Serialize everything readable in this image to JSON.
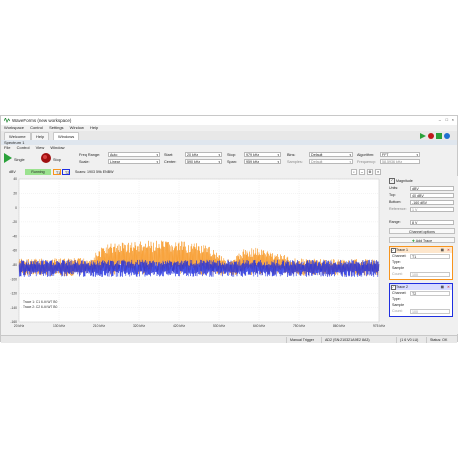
{
  "window": {
    "title": "WaveForms (new workspace)"
  },
  "menu": [
    "Workspace",
    "Control",
    "Settings",
    "Window",
    "Help"
  ],
  "tabs": [
    {
      "label": "Welcome"
    },
    {
      "label": "Help"
    },
    {
      "label": "Windows"
    }
  ],
  "document": {
    "title": "Spectrum 1"
  },
  "doc_menu": [
    "File",
    "Control",
    "View",
    "Window"
  ],
  "toolbar": {
    "single_label": "Single",
    "stop_label": "Stop",
    "freq_range_label": "Freq Range:",
    "freq_range_value": "Auto",
    "scale_label": "Scale:",
    "scale_value": "Linear",
    "start_label": "Start:",
    "start_value": "20 kHz",
    "center_label": "Center:",
    "center_value": "590 kHz",
    "stop_freq_label": "Stop:",
    "stop_freq_value": "979 kHz",
    "span_label": "Span:",
    "span_value": "959 kHz",
    "bins_label": "Bins:",
    "bins_value": "Default",
    "samples_label": "Samples:",
    "samples_value": "Default",
    "algorithm_label": "Algorithm:",
    "algorithm_value": "FFT",
    "frequency_label": "Frequency:",
    "frequency_value": "58.5936 kHz"
  },
  "plotbar": {
    "unit": "dBV",
    "status": "Running",
    "trace_buttons": [
      "T1",
      "T2"
    ],
    "info": "Scans: 1903 59k ENBW"
  },
  "panel": {
    "magnitude_label": "Magnitude",
    "units_label": "Units:",
    "units_value": "dBV",
    "top_label": "Top:",
    "top_value": "40 dBV",
    "bottom_label": "Bottom:",
    "bottom_value": "-160 dBV",
    "reference_label": "Reference:",
    "reference_value": "1 V",
    "range_label": "Range:",
    "range_value": "8 V",
    "channel_options": "Channel options",
    "add_trace": "Add Trace",
    "traces": [
      {
        "name": "Trace 1",
        "channel_label": "Channel:",
        "channel_value": "T1",
        "type_label": "Type:",
        "type_value": "Sample",
        "count_label": "Count:",
        "count_value": "100",
        "color": "#f7941d"
      },
      {
        "name": "Trace 2",
        "channel_label": "Channel:",
        "channel_value": "T2",
        "type_label": "Type:",
        "type_value": "Sample",
        "count_label": "Count:",
        "count_value": "100",
        "color": "#1f2fe0"
      }
    ]
  },
  "legend": [
    {
      "text": "Trace 1: C1 6.4t W7 B0"
    },
    {
      "text": "Trace 2: C2 6.4t W7 B0"
    }
  ],
  "statusbar": {
    "trigger": "Manual Trigger",
    "device": "AD2 (SN:210321A9E2 8A3)",
    "voltage": "(1 6 V0 LU)",
    "status": "Status: OK"
  },
  "chart_data": {
    "type": "line",
    "xlabel": "",
    "ylabel": "",
    "x_ticks": [
      "20 kHz",
      "130 kHz",
      "210 kHz",
      "320 kHz",
      "420 kHz",
      "530 kHz",
      "640 kHz",
      "750 kHz",
      "860 kHz",
      "975 kHz"
    ],
    "y_ticks": [
      40,
      20,
      0,
      -20,
      -40,
      -60,
      -80,
      -100,
      -120,
      -140,
      -160
    ],
    "ylim": [
      -160,
      40
    ],
    "xlim_khz": [
      20,
      979
    ],
    "grid": true,
    "series": [
      {
        "name": "Trace 1",
        "color": "#f7941d",
        "x": [
          20,
          130,
          210,
          230,
          250,
          280,
          320,
          400,
          480,
          530,
          560,
          575,
          590,
          605,
          620,
          650,
          700,
          760,
          860,
          979
        ],
        "y_top": [
          -71,
          -71,
          -70,
          -60,
          -51,
          -48,
          -47,
          -46,
          -48,
          -55,
          -65,
          -72,
          -73,
          -64,
          -57,
          -55,
          -62,
          -71,
          -72,
          -72
        ],
        "y_bottom": [
          -95,
          -96,
          -95,
          -94,
          -94,
          -94,
          -94,
          -94,
          -94,
          -94,
          -95,
          -95,
          -95,
          -95,
          -95,
          -94,
          -94,
          -95,
          -95,
          -95
        ]
      },
      {
        "name": "Trace 2",
        "color": "#1f2fe0",
        "x": [
          20,
          979
        ],
        "y_top": [
          -73,
          -73
        ],
        "y_bottom": [
          -97,
          -97
        ]
      }
    ]
  }
}
